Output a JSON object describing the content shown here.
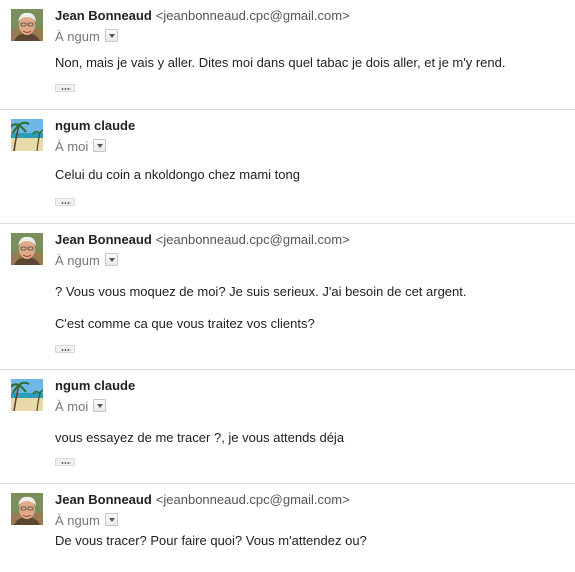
{
  "messages": [
    {
      "sender_name": "Jean Bonneaud",
      "sender_email": "<jeanbonneaud.cpc@gmail.com>",
      "recipient": "À ngum",
      "avatar": "portrait-photo",
      "body": [
        "Non, mais je vais y aller. Dites moi dans quel tabac je dois aller, et je m'y rend."
      ],
      "has_quoted_toggle": true
    },
    {
      "sender_name": "ngum claude",
      "sender_email": "",
      "recipient": "À moi",
      "avatar": "beach-photo",
      "body": [
        "Celui du coin a nkoldongo chez mami tong"
      ],
      "has_quoted_toggle": true
    },
    {
      "sender_name": "Jean Bonneaud",
      "sender_email": "<jeanbonneaud.cpc@gmail.com>",
      "recipient": "À ngum",
      "avatar": "portrait-photo",
      "body": [
        "? Vous vous moquez de moi? Je suis serieux. J'ai besoin de cet argent.",
        "C'est comme ca que vous traitez vos clients?"
      ],
      "has_quoted_toggle": true
    },
    {
      "sender_name": "ngum claude",
      "sender_email": "",
      "recipient": "À moi",
      "avatar": "beach-photo",
      "body": [
        "vous essayez de me tracer ?, je vous attends déja"
      ],
      "has_quoted_toggle": true
    },
    {
      "sender_name": "Jean Bonneaud",
      "sender_email": "<jeanbonneaud.cpc@gmail.com>",
      "recipient": "À ngum",
      "avatar": "portrait-photo",
      "body": [
        "De vous tracer? Pour faire quoi? Vous m'attendez ou?"
      ],
      "has_quoted_toggle": false
    }
  ]
}
